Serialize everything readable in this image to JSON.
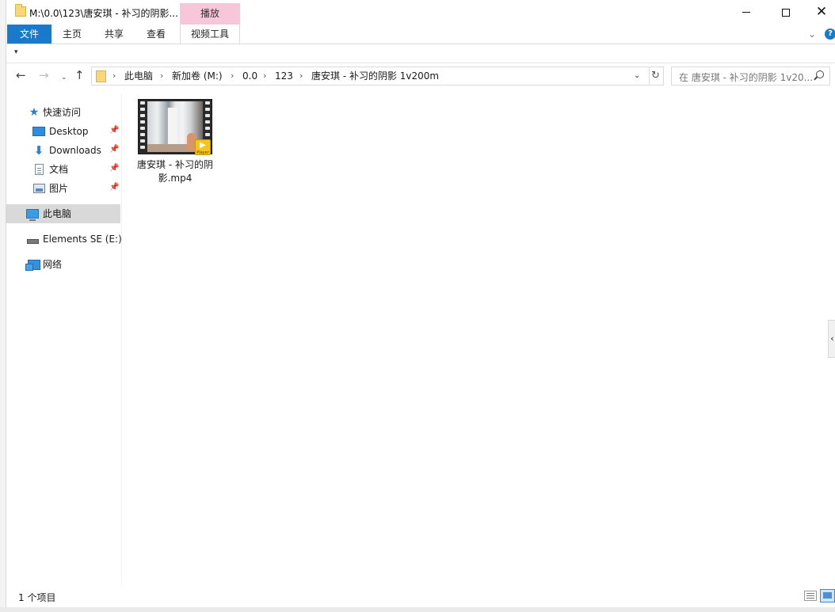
{
  "window": {
    "title": "M:\\0.0\\123\\唐安琪 - 补习的阴影...",
    "context_tab_header": "播放"
  },
  "ribbon": {
    "tabs": {
      "file": "文件",
      "home": "主页",
      "share": "共享",
      "view": "查看",
      "video_tools": "视频工具"
    }
  },
  "address": {
    "crumbs": [
      "此电脑",
      "新加卷 (M:)",
      "0.0",
      "123",
      "唐安琪 - 补习的阴影 1v200m"
    ],
    "search_placeholder": "在 唐安琪 - 补习的阴影 1v20..."
  },
  "sidebar": {
    "items": [
      {
        "label": "快速访问",
        "icon": "star-icon"
      },
      {
        "label": "Desktop",
        "icon": "desktop-icon",
        "pinned": true
      },
      {
        "label": "Downloads",
        "icon": "download-arrow-icon",
        "pinned": true
      },
      {
        "label": "文档",
        "icon": "document-icon",
        "pinned": true
      },
      {
        "label": "图片",
        "icon": "pictures-icon",
        "pinned": true
      },
      {
        "label": "此电脑",
        "icon": "computer-icon",
        "selected": true
      },
      {
        "label": "Elements SE (E:)",
        "icon": "drive-icon"
      },
      {
        "label": "网络",
        "icon": "network-icon"
      }
    ]
  },
  "content": {
    "files": [
      {
        "name": "唐安琪 - 补习的阴影.mp4",
        "badge": "Player",
        "type": "video"
      }
    ]
  },
  "status": {
    "item_count": "1 个项目"
  },
  "colors": {
    "file_tab": "#1979ca",
    "context_tab": "#f7c6d9",
    "selection": "#d9d9d9"
  }
}
